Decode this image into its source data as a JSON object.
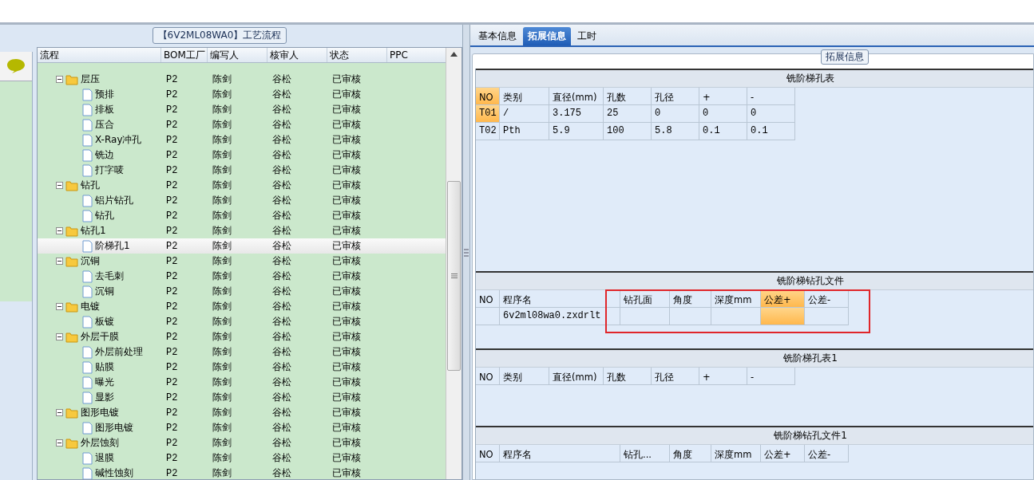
{
  "flow_panel": {
    "title": "【6V2ML08WA0】工艺流程",
    "columns": [
      "流程",
      "BOM工厂",
      "编写人",
      "核审人",
      "状态",
      "PPC"
    ],
    "tree": [
      {
        "label": "层压",
        "bom": "P2",
        "writer": "陈剑",
        "reviewer": "谷松",
        "status": "已审核",
        "expanded": true,
        "selected": false,
        "children": [
          {
            "label": "预排",
            "bom": "P2",
            "writer": "陈剑",
            "reviewer": "谷松",
            "status": "已审核",
            "selected": false
          },
          {
            "label": "排板",
            "bom": "P2",
            "writer": "陈剑",
            "reviewer": "谷松",
            "status": "已审核",
            "selected": false
          },
          {
            "label": "压合",
            "bom": "P2",
            "writer": "陈剑",
            "reviewer": "谷松",
            "status": "已审核",
            "selected": false
          },
          {
            "label": "X-Ray冲孔",
            "bom": "P2",
            "writer": "陈剑",
            "reviewer": "谷松",
            "status": "已审核",
            "selected": false
          },
          {
            "label": "铣边",
            "bom": "P2",
            "writer": "陈剑",
            "reviewer": "谷松",
            "status": "已审核",
            "selected": false
          },
          {
            "label": "打字唛",
            "bom": "P2",
            "writer": "陈剑",
            "reviewer": "谷松",
            "status": "已审核",
            "selected": false
          }
        ]
      },
      {
        "label": "钻孔",
        "bom": "P2",
        "writer": "陈剑",
        "reviewer": "谷松",
        "status": "已审核",
        "expanded": true,
        "selected": false,
        "children": [
          {
            "label": "铝片钻孔",
            "bom": "P2",
            "writer": "陈剑",
            "reviewer": "谷松",
            "status": "已审核",
            "selected": false
          },
          {
            "label": "钻孔",
            "bom": "P2",
            "writer": "陈剑",
            "reviewer": "谷松",
            "status": "已审核",
            "selected": false
          }
        ]
      },
      {
        "label": "钻孔1",
        "bom": "P2",
        "writer": "陈剑",
        "reviewer": "谷松",
        "status": "已审核",
        "expanded": true,
        "selected": false,
        "children": [
          {
            "label": "阶梯孔1",
            "bom": "P2",
            "writer": "陈剑",
            "reviewer": "谷松",
            "status": "已审核",
            "selected": true
          }
        ]
      },
      {
        "label": "沉铜",
        "bom": "P2",
        "writer": "陈剑",
        "reviewer": "谷松",
        "status": "已审核",
        "expanded": true,
        "selected": false,
        "children": [
          {
            "label": "去毛刺",
            "bom": "P2",
            "writer": "陈剑",
            "reviewer": "谷松",
            "status": "已审核",
            "selected": false
          },
          {
            "label": "沉铜",
            "bom": "P2",
            "writer": "陈剑",
            "reviewer": "谷松",
            "status": "已审核",
            "selected": false
          }
        ]
      },
      {
        "label": "电镀",
        "bom": "P2",
        "writer": "陈剑",
        "reviewer": "谷松",
        "status": "已审核",
        "expanded": true,
        "selected": false,
        "children": [
          {
            "label": "板镀",
            "bom": "P2",
            "writer": "陈剑",
            "reviewer": "谷松",
            "status": "已审核",
            "selected": false
          }
        ]
      },
      {
        "label": "外层干膜",
        "bom": "P2",
        "writer": "陈剑",
        "reviewer": "谷松",
        "status": "已审核",
        "expanded": true,
        "selected": false,
        "children": [
          {
            "label": "外层前处理",
            "bom": "P2",
            "writer": "陈剑",
            "reviewer": "谷松",
            "status": "已审核",
            "selected": false
          },
          {
            "label": "贴膜",
            "bom": "P2",
            "writer": "陈剑",
            "reviewer": "谷松",
            "status": "已审核",
            "selected": false
          },
          {
            "label": "曝光",
            "bom": "P2",
            "writer": "陈剑",
            "reviewer": "谷松",
            "status": "已审核",
            "selected": false
          },
          {
            "label": "显影",
            "bom": "P2",
            "writer": "陈剑",
            "reviewer": "谷松",
            "status": "已审核",
            "selected": false
          }
        ]
      },
      {
        "label": "图形电镀",
        "bom": "P2",
        "writer": "陈剑",
        "reviewer": "谷松",
        "status": "已审核",
        "expanded": true,
        "selected": false,
        "children": [
          {
            "label": "图形电镀",
            "bom": "P2",
            "writer": "陈剑",
            "reviewer": "谷松",
            "status": "已审核",
            "selected": false
          }
        ]
      },
      {
        "label": "外层蚀刻",
        "bom": "P2",
        "writer": "陈剑",
        "reviewer": "谷松",
        "status": "已审核",
        "expanded": true,
        "selected": false,
        "children": [
          {
            "label": "退膜",
            "bom": "P2",
            "writer": "陈剑",
            "reviewer": "谷松",
            "status": "已审核",
            "selected": false
          },
          {
            "label": "碱性蚀刻",
            "bom": "P2",
            "writer": "陈剑",
            "reviewer": "谷松",
            "status": "已审核",
            "selected": false
          }
        ]
      }
    ]
  },
  "tabs": [
    {
      "label": "基本信息",
      "selected": false
    },
    {
      "label": "拓展信息",
      "selected": true
    },
    {
      "label": "工时",
      "selected": false
    }
  ],
  "group_title": "拓展信息",
  "sections": [
    {
      "title": "铣阶梯孔表",
      "annotated": false,
      "columns": [
        {
          "label": "NO",
          "highlighted": true
        },
        {
          "label": "类别",
          "highlighted": false
        },
        {
          "label": "直径(mm)",
          "highlighted": false
        },
        {
          "label": "孔数",
          "highlighted": false
        },
        {
          "label": "孔径",
          "highlighted": false
        },
        {
          "label": "+",
          "highlighted": false
        },
        {
          "label": "-",
          "highlighted": false
        }
      ],
      "rows": [
        {
          "current": true,
          "cells": [
            "T01",
            "/",
            "3.175",
            "25",
            "0",
            "0",
            "0"
          ]
        },
        {
          "current": false,
          "cells": [
            "T02",
            "Pth",
            "5.9",
            "100",
            "5.8",
            "0.1",
            "0.1"
          ]
        }
      ]
    },
    {
      "title": "铣阶梯钻孔文件",
      "annotated": true,
      "columns": [
        {
          "label": "NO",
          "highlighted": false
        },
        {
          "label": "程序名",
          "highlighted": false
        },
        {
          "label": "钻孔面",
          "highlighted": false
        },
        {
          "label": "角度",
          "highlighted": false
        },
        {
          "label": "深度mm",
          "highlighted": false
        },
        {
          "label": "公差+",
          "highlighted": true
        },
        {
          "label": "公差-",
          "highlighted": false
        }
      ],
      "rows": [
        {
          "current": true,
          "cells": [
            "",
            "6v2ml08wa0.zxdrlt",
            "",
            "",
            "",
            "",
            ""
          ]
        }
      ]
    },
    {
      "title": "铣阶梯孔表1",
      "annotated": false,
      "columns": [
        {
          "label": "NO",
          "highlighted": false
        },
        {
          "label": "类别",
          "highlighted": false
        },
        {
          "label": "直径(mm)",
          "highlighted": false
        },
        {
          "label": "孔数",
          "highlighted": false
        },
        {
          "label": "孔径",
          "highlighted": false
        },
        {
          "label": "+",
          "highlighted": false
        },
        {
          "label": "-",
          "highlighted": false
        }
      ]
    },
    {
      "title": "铣阶梯钻孔文件1",
      "annotated": false,
      "columns": [
        {
          "label": "NO",
          "highlighted": false
        },
        {
          "label": "程序名",
          "highlighted": false
        },
        {
          "label": "钻孔...",
          "highlighted": false
        },
        {
          "label": "角度",
          "highlighted": false
        },
        {
          "label": "深度mm",
          "highlighted": false
        },
        {
          "label": "公差+",
          "highlighted": false
        },
        {
          "label": "公差-",
          "highlighted": false
        }
      ]
    }
  ]
}
